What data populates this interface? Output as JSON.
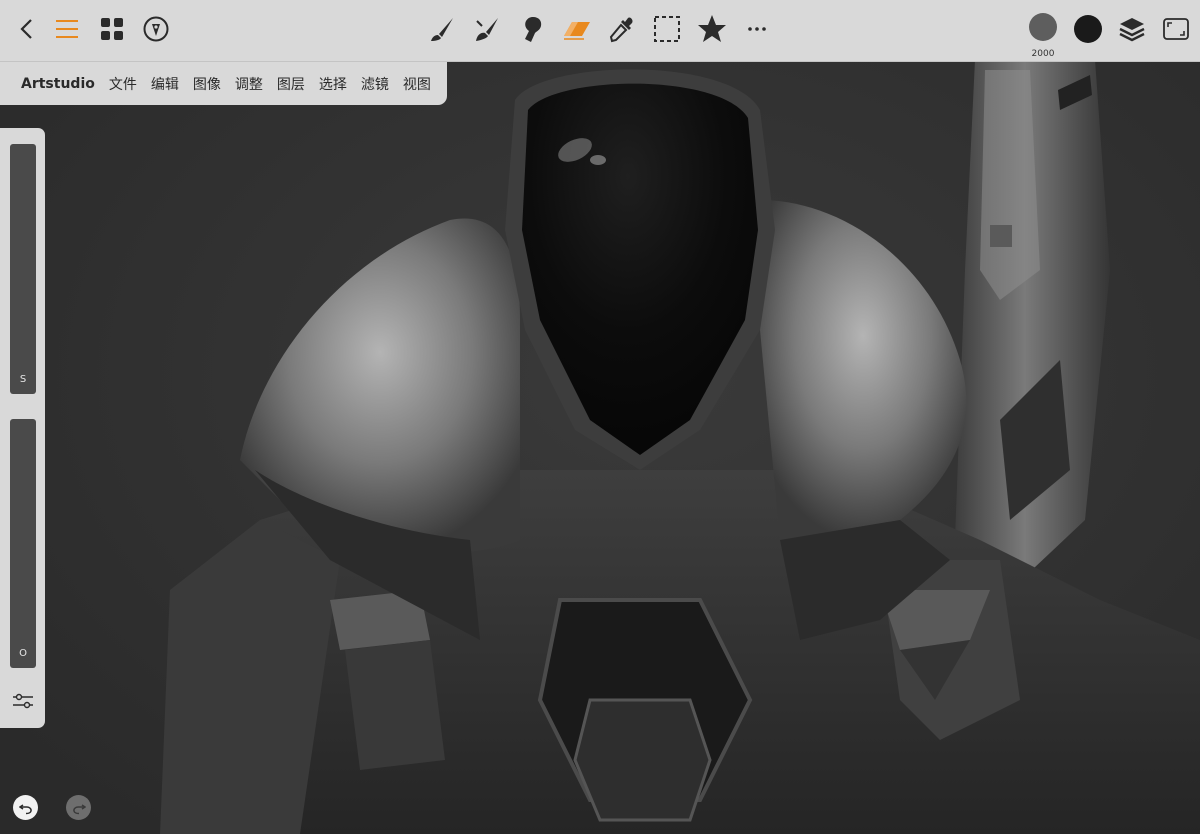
{
  "app": {
    "brand": "Artstudio",
    "menu": [
      "文件",
      "编辑",
      "图像",
      "调整",
      "图层",
      "选择",
      "滤镜",
      "视图"
    ]
  },
  "toolbar": {
    "left_icons": [
      "back-chevron-icon",
      "menu-hamburger-icon",
      "grid-apps-icon",
      "pen-nib-icon"
    ],
    "tools": [
      "brush-icon",
      "paint-brush-icon",
      "smudge-finger-icon",
      "eraser-icon",
      "eyedropper-icon",
      "marquee-select-icon",
      "favorite-star-icon",
      "more-dots-icon"
    ],
    "active_tool": "eraser-icon",
    "right_icons": [
      "brush-size-preview",
      "color-swatch",
      "layers-icon",
      "fullscreen-icon"
    ],
    "brush_size": "2000",
    "active_color": "#1a1a1a",
    "accent_color": "#e8891e"
  },
  "left_panel": {
    "size_slider_label": "S",
    "opacity_slider_label": "O"
  },
  "history": {
    "undo_enabled": true,
    "redo_enabled": false
  }
}
